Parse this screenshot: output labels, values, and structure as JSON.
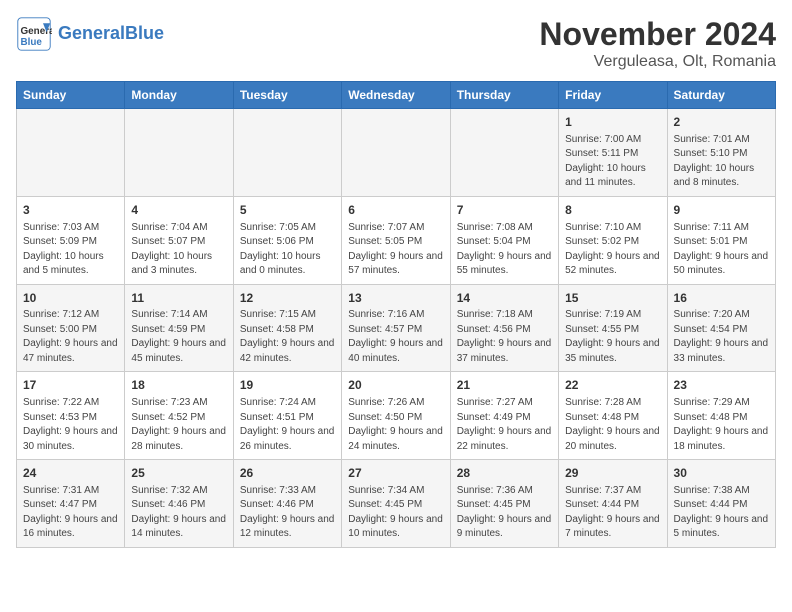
{
  "logo": {
    "text_general": "General",
    "text_blue": "Blue"
  },
  "header": {
    "month": "November 2024",
    "location": "Verguleasa, Olt, Romania"
  },
  "weekdays": [
    "Sunday",
    "Monday",
    "Tuesday",
    "Wednesday",
    "Thursday",
    "Friday",
    "Saturday"
  ],
  "weeks": [
    [
      {
        "day": "",
        "info": ""
      },
      {
        "day": "",
        "info": ""
      },
      {
        "day": "",
        "info": ""
      },
      {
        "day": "",
        "info": ""
      },
      {
        "day": "",
        "info": ""
      },
      {
        "day": "1",
        "info": "Sunrise: 7:00 AM\nSunset: 5:11 PM\nDaylight: 10 hours and 11 minutes."
      },
      {
        "day": "2",
        "info": "Sunrise: 7:01 AM\nSunset: 5:10 PM\nDaylight: 10 hours and 8 minutes."
      }
    ],
    [
      {
        "day": "3",
        "info": "Sunrise: 7:03 AM\nSunset: 5:09 PM\nDaylight: 10 hours and 5 minutes."
      },
      {
        "day": "4",
        "info": "Sunrise: 7:04 AM\nSunset: 5:07 PM\nDaylight: 10 hours and 3 minutes."
      },
      {
        "day": "5",
        "info": "Sunrise: 7:05 AM\nSunset: 5:06 PM\nDaylight: 10 hours and 0 minutes."
      },
      {
        "day": "6",
        "info": "Sunrise: 7:07 AM\nSunset: 5:05 PM\nDaylight: 9 hours and 57 minutes."
      },
      {
        "day": "7",
        "info": "Sunrise: 7:08 AM\nSunset: 5:04 PM\nDaylight: 9 hours and 55 minutes."
      },
      {
        "day": "8",
        "info": "Sunrise: 7:10 AM\nSunset: 5:02 PM\nDaylight: 9 hours and 52 minutes."
      },
      {
        "day": "9",
        "info": "Sunrise: 7:11 AM\nSunset: 5:01 PM\nDaylight: 9 hours and 50 minutes."
      }
    ],
    [
      {
        "day": "10",
        "info": "Sunrise: 7:12 AM\nSunset: 5:00 PM\nDaylight: 9 hours and 47 minutes."
      },
      {
        "day": "11",
        "info": "Sunrise: 7:14 AM\nSunset: 4:59 PM\nDaylight: 9 hours and 45 minutes."
      },
      {
        "day": "12",
        "info": "Sunrise: 7:15 AM\nSunset: 4:58 PM\nDaylight: 9 hours and 42 minutes."
      },
      {
        "day": "13",
        "info": "Sunrise: 7:16 AM\nSunset: 4:57 PM\nDaylight: 9 hours and 40 minutes."
      },
      {
        "day": "14",
        "info": "Sunrise: 7:18 AM\nSunset: 4:56 PM\nDaylight: 9 hours and 37 minutes."
      },
      {
        "day": "15",
        "info": "Sunrise: 7:19 AM\nSunset: 4:55 PM\nDaylight: 9 hours and 35 minutes."
      },
      {
        "day": "16",
        "info": "Sunrise: 7:20 AM\nSunset: 4:54 PM\nDaylight: 9 hours and 33 minutes."
      }
    ],
    [
      {
        "day": "17",
        "info": "Sunrise: 7:22 AM\nSunset: 4:53 PM\nDaylight: 9 hours and 30 minutes."
      },
      {
        "day": "18",
        "info": "Sunrise: 7:23 AM\nSunset: 4:52 PM\nDaylight: 9 hours and 28 minutes."
      },
      {
        "day": "19",
        "info": "Sunrise: 7:24 AM\nSunset: 4:51 PM\nDaylight: 9 hours and 26 minutes."
      },
      {
        "day": "20",
        "info": "Sunrise: 7:26 AM\nSunset: 4:50 PM\nDaylight: 9 hours and 24 minutes."
      },
      {
        "day": "21",
        "info": "Sunrise: 7:27 AM\nSunset: 4:49 PM\nDaylight: 9 hours and 22 minutes."
      },
      {
        "day": "22",
        "info": "Sunrise: 7:28 AM\nSunset: 4:48 PM\nDaylight: 9 hours and 20 minutes."
      },
      {
        "day": "23",
        "info": "Sunrise: 7:29 AM\nSunset: 4:48 PM\nDaylight: 9 hours and 18 minutes."
      }
    ],
    [
      {
        "day": "24",
        "info": "Sunrise: 7:31 AM\nSunset: 4:47 PM\nDaylight: 9 hours and 16 minutes."
      },
      {
        "day": "25",
        "info": "Sunrise: 7:32 AM\nSunset: 4:46 PM\nDaylight: 9 hours and 14 minutes."
      },
      {
        "day": "26",
        "info": "Sunrise: 7:33 AM\nSunset: 4:46 PM\nDaylight: 9 hours and 12 minutes."
      },
      {
        "day": "27",
        "info": "Sunrise: 7:34 AM\nSunset: 4:45 PM\nDaylight: 9 hours and 10 minutes."
      },
      {
        "day": "28",
        "info": "Sunrise: 7:36 AM\nSunset: 4:45 PM\nDaylight: 9 hours and 9 minutes."
      },
      {
        "day": "29",
        "info": "Sunrise: 7:37 AM\nSunset: 4:44 PM\nDaylight: 9 hours and 7 minutes."
      },
      {
        "day": "30",
        "info": "Sunrise: 7:38 AM\nSunset: 4:44 PM\nDaylight: 9 hours and 5 minutes."
      }
    ]
  ]
}
